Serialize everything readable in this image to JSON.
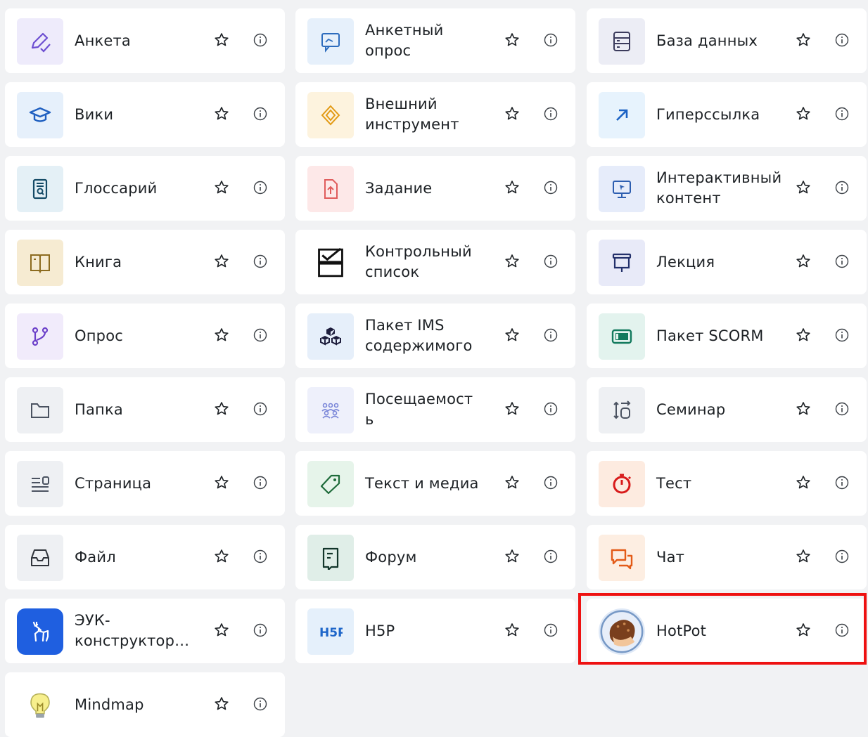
{
  "colors": {
    "highlight": "#ee1111",
    "card_bg": "#ffffff",
    "page_bg": "#f1f2f4"
  },
  "activities": [
    {
      "name": "Анкета",
      "icon": "pencil-check-icon"
    },
    {
      "name": "Анкетный опрос",
      "icon": "feedback-icon"
    },
    {
      "name": "База данных",
      "icon": "database-icon"
    },
    {
      "name": "Вики",
      "icon": "graduation-cap-icon"
    },
    {
      "name": "Внешний инструмент",
      "icon": "puzzle-icon"
    },
    {
      "name": "Гиперссылка",
      "icon": "arrow-up-right-icon"
    },
    {
      "name": "Глоссарий",
      "icon": "glossary-icon"
    },
    {
      "name": "Задание",
      "icon": "assignment-upload-icon"
    },
    {
      "name": "Интерактивный контент",
      "icon": "monitor-icon"
    },
    {
      "name": "Книга",
      "icon": "book-icon"
    },
    {
      "name": "Контрольный список",
      "icon": "checklist-icon"
    },
    {
      "name": "Лекция",
      "icon": "lesson-icon"
    },
    {
      "name": "Опрос",
      "icon": "choice-icon"
    },
    {
      "name": "Пакет IMS содержимого",
      "icon": "cubes-icon"
    },
    {
      "name": "Пакет SCORM",
      "icon": "scorm-icon"
    },
    {
      "name": "Папка",
      "icon": "folder-icon"
    },
    {
      "name": "Посещаемость",
      "icon": "attendance-people-icon"
    },
    {
      "name": "Семинар",
      "icon": "workshop-icon"
    },
    {
      "name": "Страница",
      "icon": "page-icon"
    },
    {
      "name": "Текст и медиа",
      "icon": "tag-icon"
    },
    {
      "name": "Тест",
      "icon": "quiz-timer-icon"
    },
    {
      "name": "Файл",
      "icon": "inbox-file-icon"
    },
    {
      "name": "Форум",
      "icon": "forum-icon"
    },
    {
      "name": "Чат",
      "icon": "chat-icon"
    },
    {
      "name": "ЭУК-конструктор…",
      "icon": "deer-logo-icon"
    },
    {
      "name": "H5P",
      "icon": "h5p-icon"
    },
    {
      "name": "HotPot",
      "icon": "hotpot-hand-icon"
    },
    {
      "name": "Mindmap",
      "icon": "lightbulb-icon"
    }
  ],
  "labels_display": [
    "Анкета",
    "Анкетный\nопрос",
    "База данных",
    "Вики",
    "Внешний\nинструмент",
    "Гиперссылка",
    "Глоссарий",
    "Задание",
    "Интерактивный\nконтент",
    "Книга",
    "Контрольный\nсписок",
    "Лекция",
    "Опрос",
    "Пакет IMS\nсодержимого",
    "Пакет SCORM",
    "Папка",
    "Посещаемост\nь",
    "Семинар",
    "Страница",
    "Текст и медиа",
    "Тест",
    "Файл",
    "Форум",
    "Чат",
    "ЭУК-\nконструктор…",
    "H5P",
    "HotPot",
    "Mindmap"
  ]
}
